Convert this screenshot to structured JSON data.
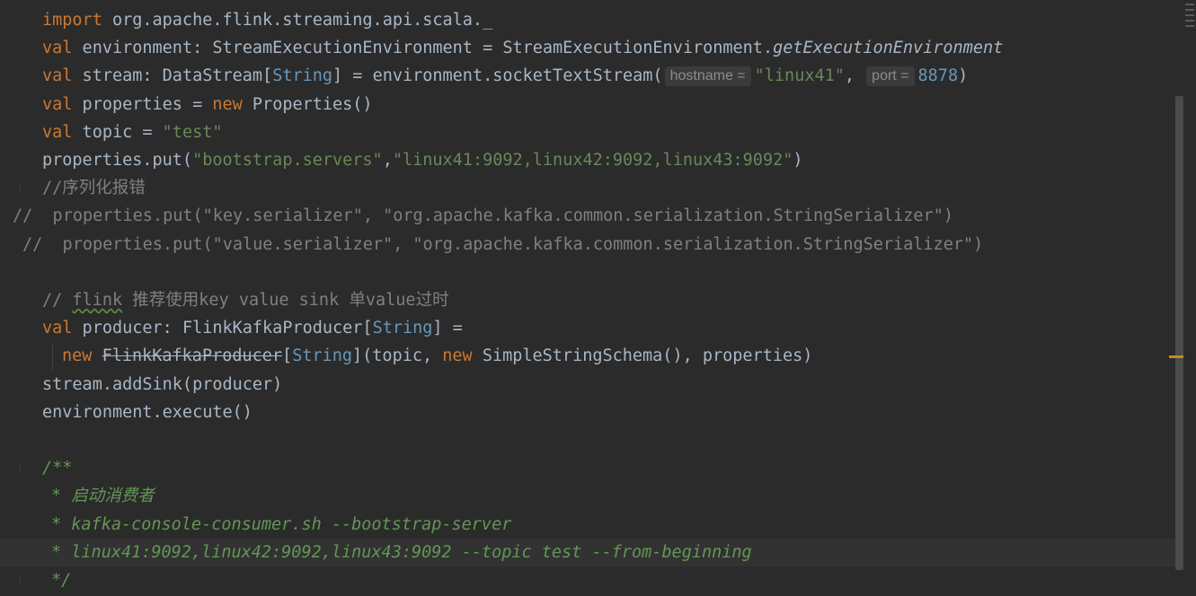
{
  "editor": {
    "lines": [
      {
        "segments": [
          {
            "t": "import",
            "c": "kw"
          },
          {
            "t": " org.apache.flink.streaming.api.scala._"
          }
        ]
      },
      {
        "segments": [
          {
            "t": "val",
            "c": "kw"
          },
          {
            "t": " environment: StreamExecutionEnvironment = StreamExecutionEnvironment."
          },
          {
            "t": "getExecutionEnvironment",
            "c": "ital"
          }
        ]
      },
      {
        "segments": [
          {
            "t": "val",
            "c": "kw"
          },
          {
            "t": " stream: DataStream["
          },
          {
            "t": "String",
            "c": "type"
          },
          {
            "t": "] = environment.socketTextStream("
          },
          {
            "hint": "hostname ="
          },
          {
            "t": "\"linux41\"",
            "c": "str"
          },
          {
            "t": ", "
          },
          {
            "hint": "port ="
          },
          {
            "t": "8878",
            "c": "type"
          },
          {
            "t": ")"
          }
        ]
      },
      {
        "segments": [
          {
            "t": "val",
            "c": "kw"
          },
          {
            "t": " properties = "
          },
          {
            "t": "new",
            "c": "kw"
          },
          {
            "t": " Properties()"
          }
        ]
      },
      {
        "segments": [
          {
            "t": "val",
            "c": "kw"
          },
          {
            "t": " topic = "
          },
          {
            "t": "\"test\"",
            "c": "str"
          }
        ]
      },
      {
        "segments": [
          {
            "t": "properties.put("
          },
          {
            "t": "\"bootstrap.servers\"",
            "c": "str"
          },
          {
            "t": ","
          },
          {
            "t": "\"linux41:9092,linux42:9092,linux43:9092\"",
            "c": "str"
          },
          {
            "t": ")"
          }
        ]
      },
      {
        "segments": [
          {
            "t": "//",
            "c": "cmt"
          },
          {
            "t": "序列化报错",
            "c": "cmt cjk"
          }
        ]
      },
      {
        "indent": 14,
        "segments": [
          {
            "t": "//  properties.put(\"key.serializer\", \"org.apache.kafka.common.serialization.StringSerializer\")",
            "c": "cmt"
          }
        ]
      },
      {
        "indent": 25,
        "segments": [
          {
            "t": "//  properties.put(\"value.serializer\", \"org.apache.kafka.common.serialization.StringSerializer\")",
            "c": "cmt"
          }
        ]
      },
      {
        "segments": []
      },
      {
        "segments": [
          {
            "t": "// ",
            "c": "cmt"
          },
          {
            "t": "flink",
            "c": "cmt squiggle"
          },
          {
            "t": " ",
            "c": "cmt"
          },
          {
            "t": "推荐使用",
            "c": "cmt cjk"
          },
          {
            "t": "key value sink ",
            "c": "cmt"
          },
          {
            "t": "单",
            "c": "cmt cjk"
          },
          {
            "t": "value",
            "c": "cmt"
          },
          {
            "t": "过时",
            "c": "cmt cjk"
          }
        ]
      },
      {
        "segments": [
          {
            "t": "val",
            "c": "kw"
          },
          {
            "t": " producer: FlinkKafkaProducer["
          },
          {
            "t": "String",
            "c": "type"
          },
          {
            "t": "] ="
          }
        ]
      },
      {
        "indent": 69,
        "segments": [
          {
            "t": "new",
            "c": "kw"
          },
          {
            "t": " "
          },
          {
            "t": "FlinkKafkaProducer",
            "c": "strike"
          },
          {
            "t": "["
          },
          {
            "t": "String",
            "c": "type"
          },
          {
            "t": "](topic, "
          },
          {
            "t": "new",
            "c": "kw"
          },
          {
            "t": " SimpleStringSchema(), properties)"
          }
        ]
      },
      {
        "segments": [
          {
            "t": "stream.addSink(producer)"
          }
        ]
      },
      {
        "segments": [
          {
            "t": "environment.execute()"
          }
        ]
      },
      {
        "segments": []
      },
      {
        "segments": [
          {
            "t": "/**",
            "c": "doc"
          }
        ]
      },
      {
        "indent": 57,
        "segments": [
          {
            "t": "* ",
            "c": "doc"
          },
          {
            "t": "启动消费者",
            "c": "doc cjk"
          }
        ]
      },
      {
        "indent": 57,
        "segments": [
          {
            "t": "* kafka-console-consumer.sh --bootstrap-server",
            "c": "doc"
          }
        ]
      },
      {
        "indent": 57,
        "current": true,
        "segments": [
          {
            "t": "* linux41:9092,linux42:9092,linux43:9092 --topic test --from-beginning",
            "c": "doc"
          }
        ]
      },
      {
        "indent": 57,
        "segments": [
          {
            "t": "*/",
            "c": "doc"
          }
        ]
      }
    ]
  }
}
